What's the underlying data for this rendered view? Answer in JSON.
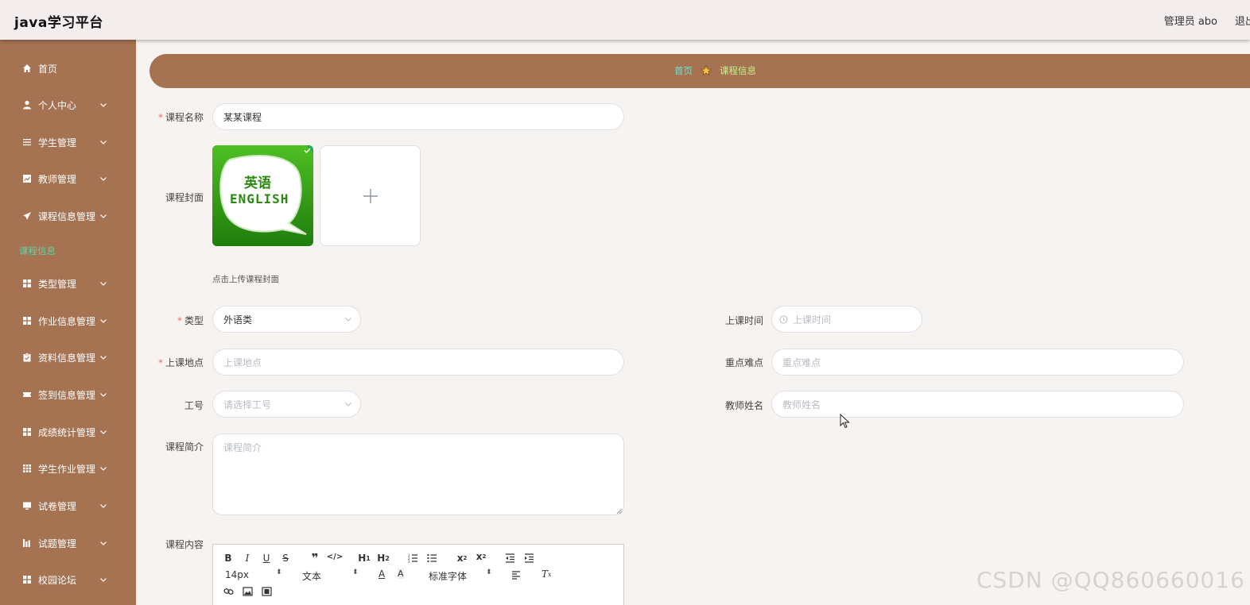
{
  "header": {
    "brand": "java学习平台",
    "user_label": "管理员 abo",
    "logout_label": "退出"
  },
  "sidebar": {
    "items": [
      {
        "label": "首页",
        "icon": "home-icon",
        "chevron": false
      },
      {
        "label": "个人中心",
        "icon": "user-icon",
        "chevron": true
      },
      {
        "label": "学生管理",
        "icon": "list-icon",
        "chevron": true
      },
      {
        "label": "教师管理",
        "icon": "chart-icon",
        "chevron": true
      },
      {
        "label": "课程信息管理",
        "icon": "send-icon",
        "chevron": true
      },
      {
        "label": "类型管理",
        "icon": "grid-icon",
        "chevron": true
      },
      {
        "label": "作业信息管理",
        "icon": "grid-icon",
        "chevron": true
      },
      {
        "label": "资料信息管理",
        "icon": "clipboard-icon",
        "chevron": true
      },
      {
        "label": "签到信息管理",
        "icon": "ticket-icon",
        "chevron": true
      },
      {
        "label": "成绩统计管理",
        "icon": "grid-icon",
        "chevron": true
      },
      {
        "label": "学生作业管理",
        "icon": "apps-icon",
        "chevron": true
      },
      {
        "label": "试卷管理",
        "icon": "monitor-icon",
        "chevron": true
      },
      {
        "label": "试题管理",
        "icon": "bars-icon",
        "chevron": true
      },
      {
        "label": "校园论坛",
        "icon": "grid-icon",
        "chevron": true
      }
    ],
    "active_sub": "课程信息"
  },
  "breadcrumb": {
    "home": "首页",
    "current": "课程信息"
  },
  "form": {
    "course_name": {
      "label": "课程名称",
      "value": "某某课程",
      "required": true
    },
    "cover": {
      "label": "课程封面",
      "image_text_top": "英语",
      "image_text_bottom": "ENGLISH",
      "tip": "点击上传课程封面"
    },
    "type": {
      "label": "类型",
      "value": "外语类",
      "required": true
    },
    "class_time": {
      "label": "上课时间",
      "placeholder": "上课时间"
    },
    "location": {
      "label": "上课地点",
      "placeholder": "上课地点",
      "required": true
    },
    "key_points": {
      "label": "重点难点",
      "placeholder": "重点难点"
    },
    "job_no": {
      "label": "工号",
      "placeholder": "请选择工号"
    },
    "teacher_name": {
      "label": "教师姓名",
      "placeholder": "教师姓名"
    },
    "intro": {
      "label": "课程简介",
      "placeholder": "课程简介"
    },
    "content": {
      "label": "课程内容"
    }
  },
  "editor_toolbar": {
    "font_size": "14px",
    "block_type": "文本",
    "font_family": "标准字体"
  },
  "watermark": "CSDN @QQ860660016",
  "colors": {
    "sidebar": "#a57252",
    "header": "#f3eeed",
    "breadcrumb_home": "#6fe0d2",
    "breadcrumb_current": "#c8f08b",
    "required": "#f56c6c"
  }
}
